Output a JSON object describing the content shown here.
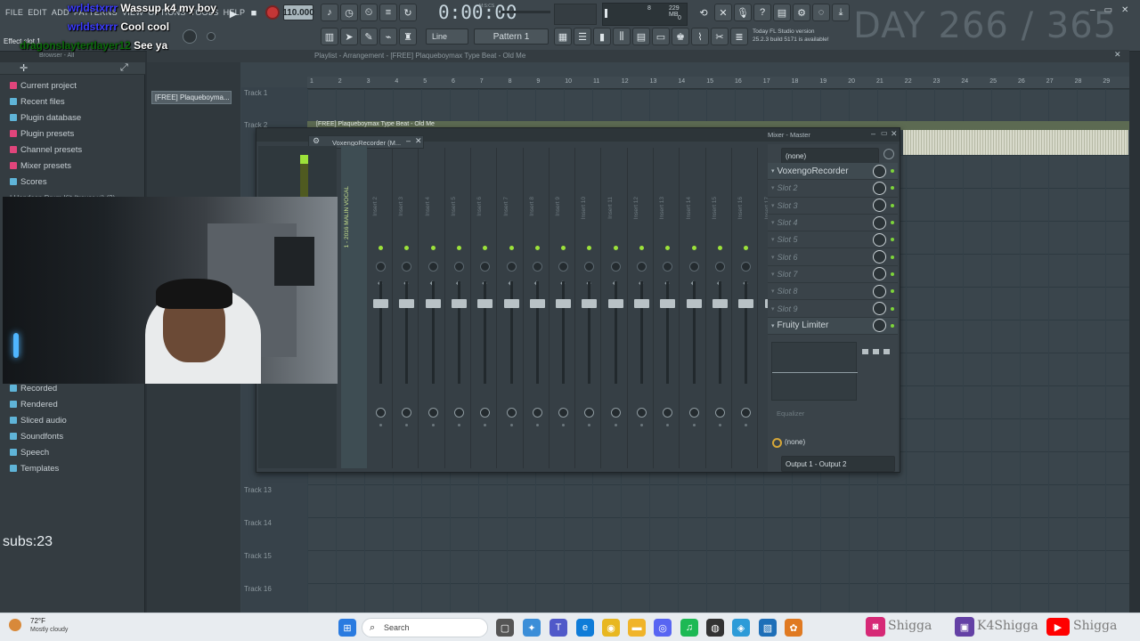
{
  "menu": [
    "FILE",
    "EDIT",
    "ADD",
    "PATTERNS",
    "VIEW",
    "OPTIONS",
    "TOOLS",
    "HELP"
  ],
  "chat": [
    {
      "user": "wrldstxrrr",
      "msg": "Wassup k4 my boy"
    },
    {
      "user": "wrldstxrrr",
      "msg": "Cool cool"
    },
    {
      "user": "dragonslaytertlayer12",
      "msg": "See ya"
    }
  ],
  "hint": "Effect slot 1",
  "transport": {
    "tempo": "110.000",
    "time": "0:00:00",
    "time_sub": "M:S:CS",
    "mem": "229 MB",
    "cpu": "8",
    "poly": "0"
  },
  "toolbar": {
    "snap": "Line",
    "pattern": "Pattern 1",
    "news_title": "Today  FL Studio version",
    "news_body": "25.2.3 build 5171 is available!"
  },
  "day_counter": "DAY 266 / 365",
  "browser": {
    "title": "Browser - All",
    "items": [
      "Current project",
      "Recent files",
      "Plugin database",
      "Plugin presets",
      "Channel presets",
      "Mixer presets",
      "Scores"
    ],
    "lower_items": [
      "Recorded",
      "Rendered",
      "Sliced audio",
      "Soundfonts",
      "Speech",
      "Templates"
    ],
    "partial": "I Hondson Drum Kit (trevor ui) (2)",
    "subs": "subs:23"
  },
  "playlist": {
    "title": "Playlist - Arrangement - [FREE] Plaqueboymax Type Beat - Old Me",
    "pattern_block": "[FREE] Plaqueboyma...",
    "clip_label": "[FREE] Plaqueboymax Type Beat - Old Me",
    "ruler": [
      "1",
      "2",
      "3",
      "4",
      "5",
      "6",
      "7",
      "8",
      "9",
      "10",
      "11",
      "12",
      "13",
      "14",
      "15",
      "16",
      "17",
      "18",
      "19",
      "20",
      "21",
      "22",
      "23",
      "24",
      "25",
      "26",
      "27",
      "28",
      "29"
    ],
    "tracks": [
      "Track 1",
      "Track 2",
      "Track 13",
      "Track 14",
      "Track 15",
      "Track 16"
    ]
  },
  "mixer": {
    "title": "Mixer - Master",
    "plugin_window": "VoxengoRecorder (M...",
    "first_insert": "1 - 2016 MALIN VOCAL",
    "inserts": [
      "Insert 2",
      "Insert 3",
      "Insert 4",
      "Insert 5",
      "Insert 6",
      "Insert 7",
      "Insert 8",
      "Insert 9",
      "Insert 10",
      "Insert 11",
      "Insert 12",
      "Insert 13",
      "Insert 14",
      "Insert 15",
      "Insert 16",
      "Insert 17"
    ],
    "input": "(none)",
    "slots": [
      "VoxengoRecorder",
      "Slot 2",
      "Slot 3",
      "Slot 4",
      "Slot 5",
      "Slot 6",
      "Slot 7",
      "Slot 8",
      "Slot 9",
      "Fruity Limiter"
    ],
    "eq_label": "Equalizer",
    "send": "(none)",
    "output": "Output 1 - Output 2"
  },
  "taskbar": {
    "weather_temp": "72°F",
    "weather_desc": "Mostly cloudy",
    "search": "Search",
    "social": [
      "Shigga",
      "K4Shigga",
      "Shigga"
    ]
  },
  "colors": {
    "accent_green": "#9de23a",
    "folder_pink": "#e0457b",
    "instagram": "#d62976",
    "twitch": "#6441a5",
    "youtube": "#ff0000"
  }
}
